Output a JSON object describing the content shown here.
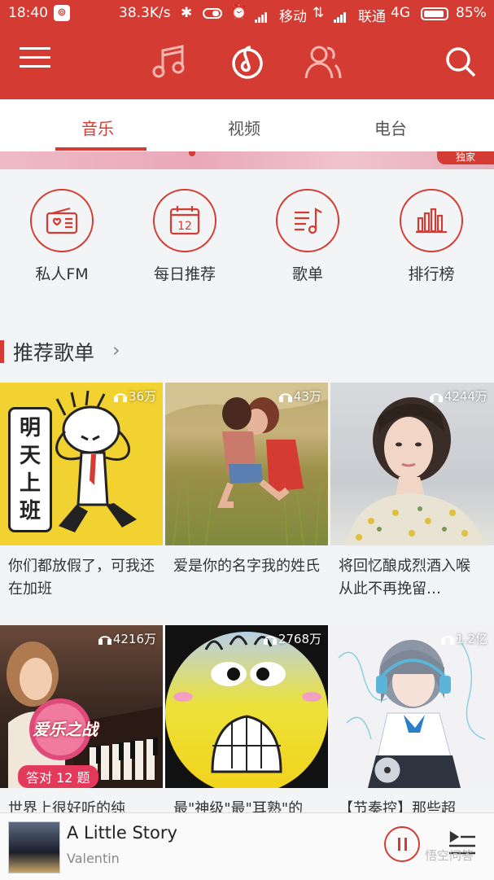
{
  "status_bar": {
    "time": "18:40",
    "app_icon": "netease-music-icon",
    "speed": "38.3K/s",
    "carrier1": "移动",
    "carrier2": "联通",
    "network": "4G",
    "battery": "85%"
  },
  "top_nav": {
    "icons": [
      "menu-icon",
      "music-note-icon",
      "netease-logo-icon",
      "friends-icon",
      "search-icon"
    ]
  },
  "tabs": [
    {
      "label": "音乐",
      "active": true
    },
    {
      "label": "视频",
      "active": false
    },
    {
      "label": "电台",
      "active": false
    }
  ],
  "banner": {
    "badge": "独家"
  },
  "quick_entries": [
    {
      "label": "私人FM",
      "icon": "radio-icon"
    },
    {
      "label": "每日推荐",
      "icon": "calendar-icon",
      "day": "12"
    },
    {
      "label": "歌单",
      "icon": "playlist-icon"
    },
    {
      "label": "排行榜",
      "icon": "chart-bars-icon"
    }
  ],
  "section": {
    "title": "推荐歌单",
    "arrow": "›"
  },
  "playlists": [
    {
      "plays": "36万",
      "title": "你们都放假了，可我还在加班",
      "cover_text": [
        "明",
        "天",
        "上",
        "班"
      ]
    },
    {
      "plays": "43万",
      "title": "爱是你的名字我的姓氏"
    },
    {
      "plays": "4244万",
      "title": "将回忆酿成烈酒入喉 从此不再挽留…"
    },
    {
      "plays": "4216万",
      "title": "世界上很好听的纯",
      "cover_text": [
        "爱乐之战",
        "答对 12 题"
      ]
    },
    {
      "plays": "2768万",
      "title": "最\"神级\"最\"耳熟\"的"
    },
    {
      "plays": "1.2亿",
      "title": "【节奏控】那些超"
    }
  ],
  "player": {
    "song": "A Little Story",
    "artist": "Valentin"
  },
  "watermark": "悟空问答",
  "colors": {
    "accent": "#d43c33",
    "background": "#f3f4f5"
  }
}
